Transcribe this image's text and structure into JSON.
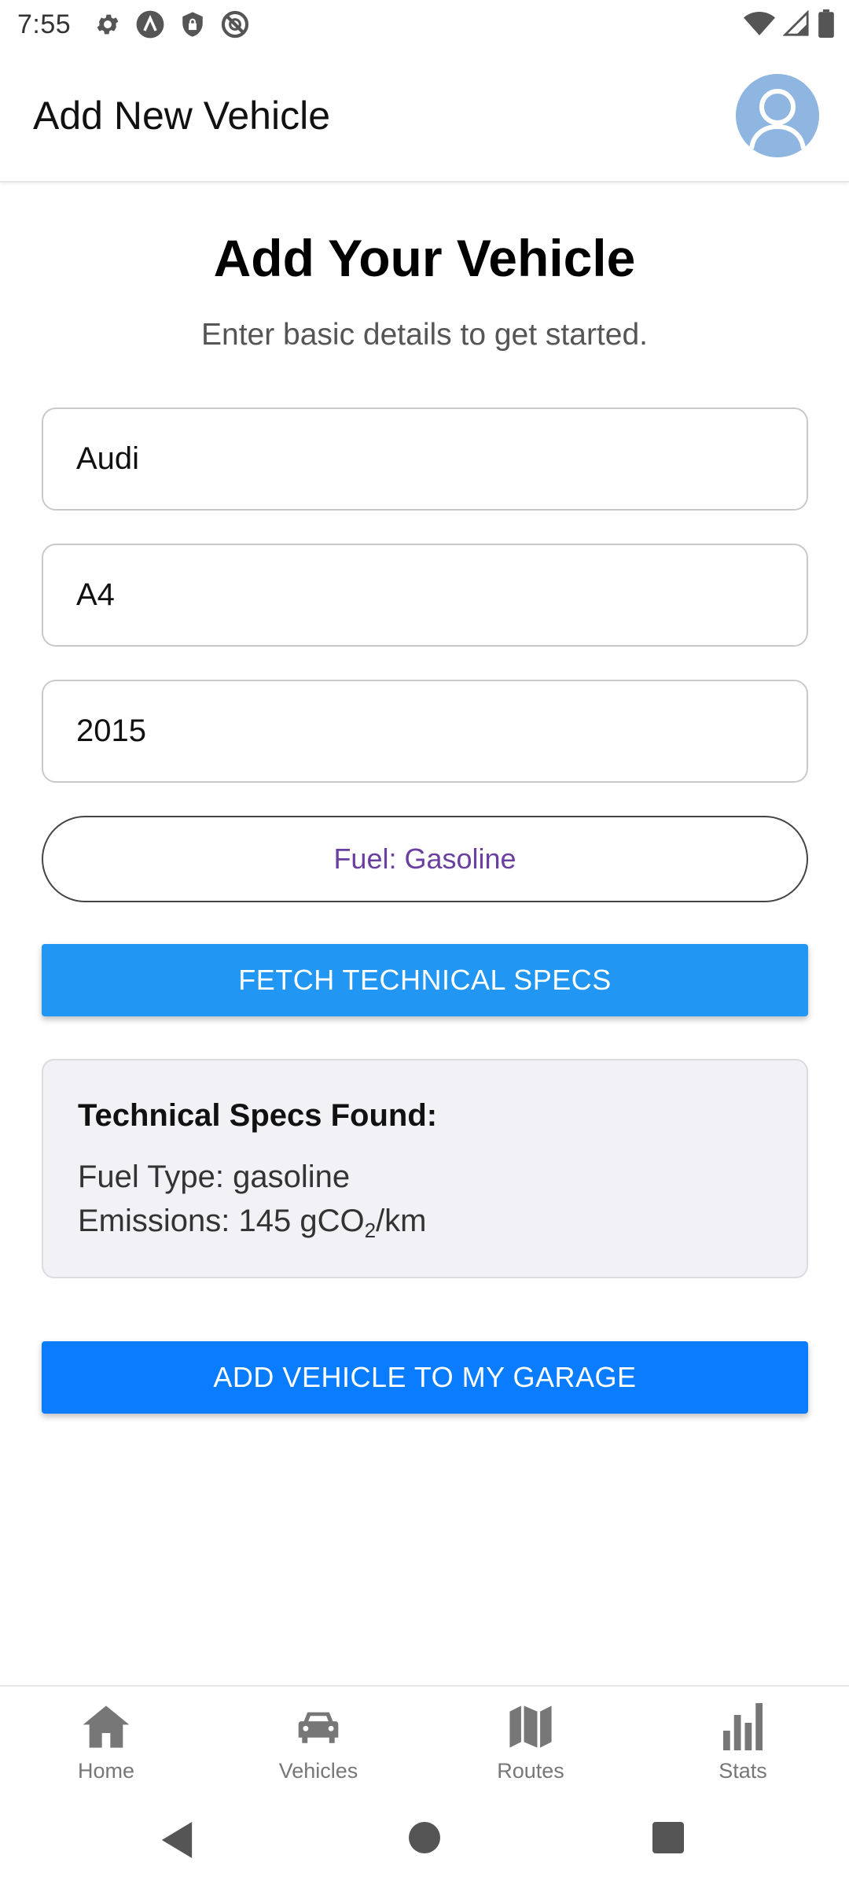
{
  "status_bar": {
    "time": "7:55",
    "left_icons": [
      "settings-icon",
      "app-a-icon",
      "vpn-lock-icon",
      "dnd-icon"
    ],
    "right_icons": [
      "wifi-icon",
      "signal-icon",
      "battery-icon"
    ]
  },
  "app_bar": {
    "title": "Add New Vehicle",
    "avatar_icon": "user-avatar-icon"
  },
  "form": {
    "heading": "Add Your Vehicle",
    "subheading": "Enter basic details to get started.",
    "make_value": "Audi",
    "model_value": "A4",
    "year_value": "2015",
    "fuel_button_label": "Fuel: Gasoline",
    "fetch_button_label": "FETCH TECHNICAL SPECS",
    "add_button_label": "ADD VEHICLE TO MY GARAGE"
  },
  "specs": {
    "title": "Technical Specs Found:",
    "fuel_type": "Fuel Type: gasoline",
    "emissions_prefix": "Emissions: 145 gCO",
    "emissions_subscript": "2",
    "emissions_suffix": "/km"
  },
  "bottom_nav": {
    "items": [
      {
        "label": "Home",
        "icon": "home-icon"
      },
      {
        "label": "Vehicles",
        "icon": "car-icon"
      },
      {
        "label": "Routes",
        "icon": "map-icon"
      },
      {
        "label": "Stats",
        "icon": "bar-chart-icon"
      }
    ]
  },
  "colors": {
    "fetch_button": "#2196f3",
    "add_button": "#0a7cff",
    "fuel_text": "#6a3fa0",
    "avatar_bg": "#8fb6e0"
  }
}
